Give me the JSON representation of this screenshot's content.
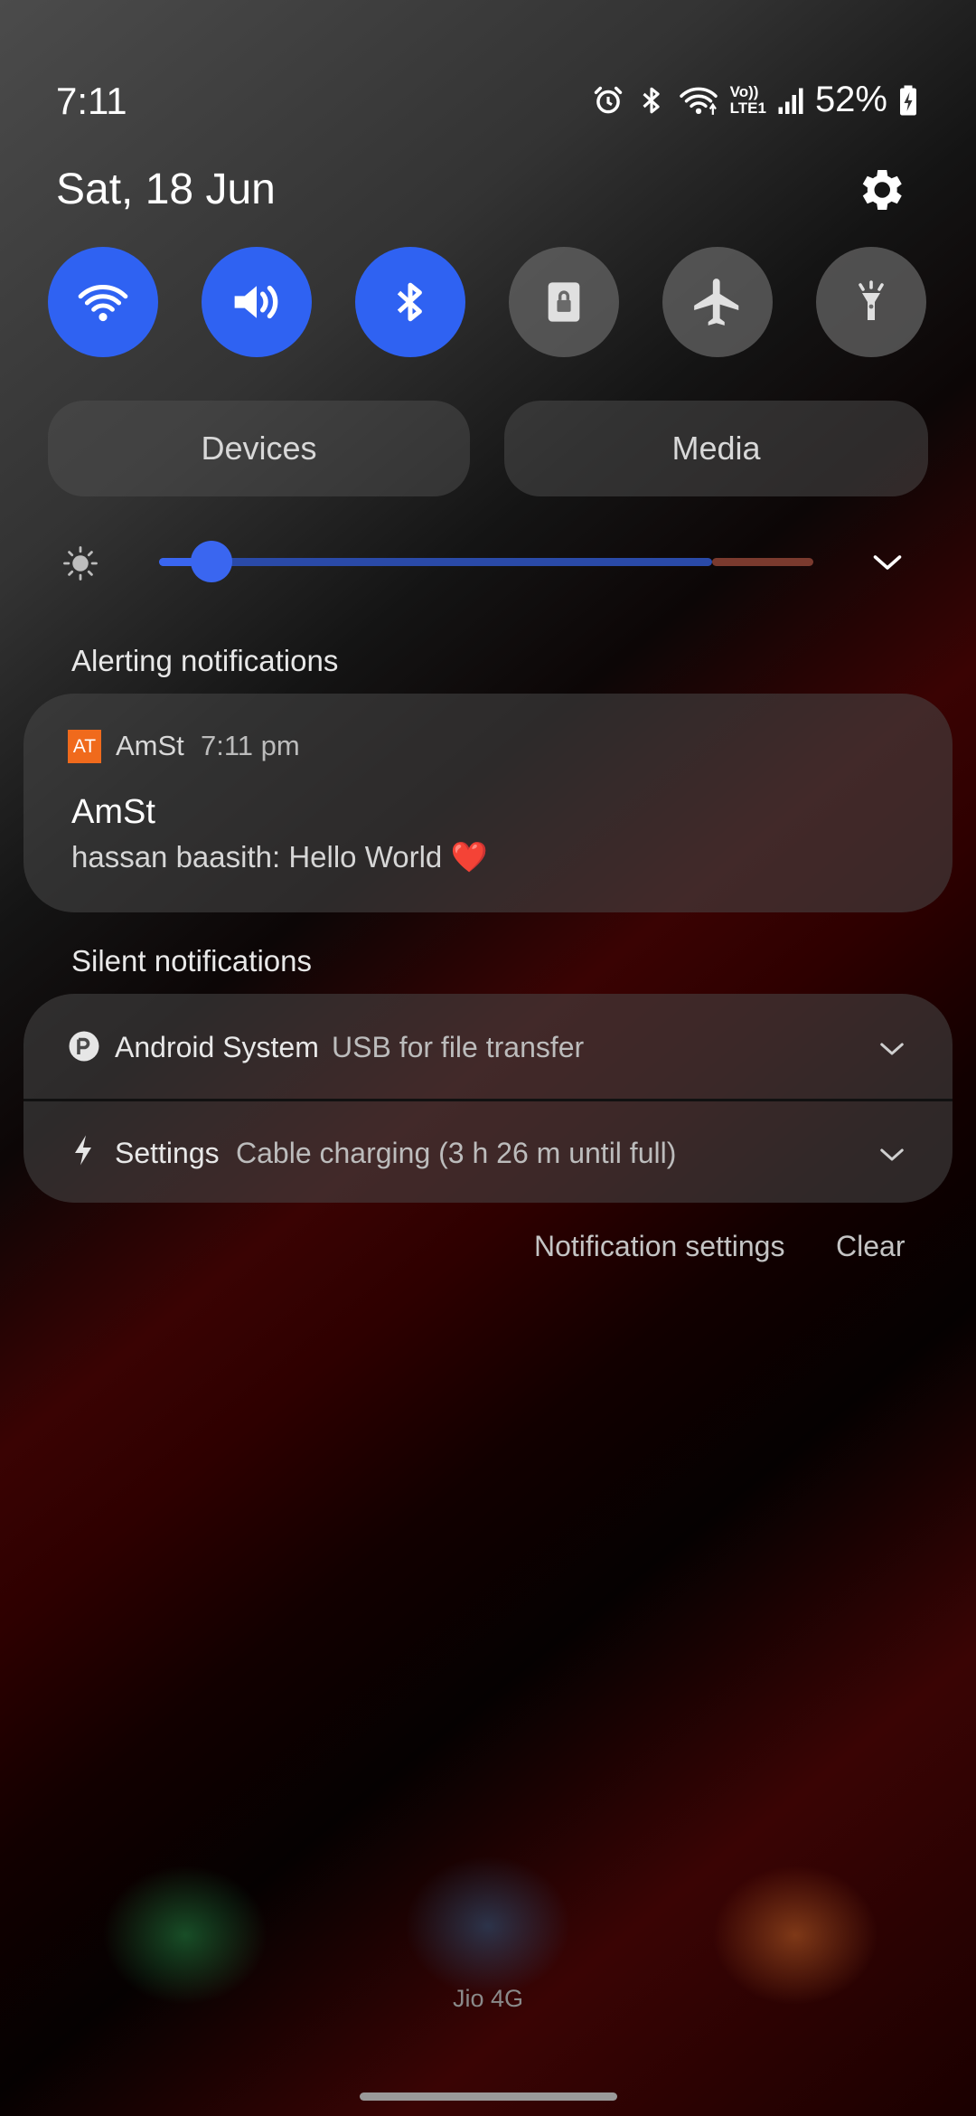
{
  "status_bar": {
    "time": "7:11",
    "battery": "52%",
    "icons": [
      "alarm-icon",
      "bluetooth-icon",
      "wifi-icon",
      "volte-lte-icon",
      "signal-icon",
      "battery-charging-icon"
    ],
    "volte_top": "Vo))",
    "volte_bottom": "LTE1"
  },
  "header": {
    "date": "Sat, 18 Jun"
  },
  "quick_toggles": [
    {
      "name": "wifi",
      "state": "on"
    },
    {
      "name": "sound",
      "state": "on"
    },
    {
      "name": "bluetooth",
      "state": "on"
    },
    {
      "name": "screen-lock",
      "state": "off"
    },
    {
      "name": "airplane-mode",
      "state": "off"
    },
    {
      "name": "flashlight",
      "state": "off"
    }
  ],
  "buttons": {
    "devices": "Devices",
    "media": "Media"
  },
  "brightness": {
    "level": 0.08
  },
  "alerting": {
    "section_label": "Alerting notifications",
    "notification": {
      "app_icon_text": "AT",
      "app_name": "AmSt",
      "time": "7:11 pm",
      "title": "AmSt",
      "message": "hassan baasith: Hello World ❤️"
    }
  },
  "silent": {
    "section_label": "Silent notifications",
    "items": [
      {
        "app": "Android System",
        "text": "USB for file transfer"
      },
      {
        "app": "Settings",
        "text": "Cable charging (3 h 26 m until full)"
      }
    ]
  },
  "actions": {
    "notification_settings": "Notification settings",
    "clear": "Clear"
  },
  "carrier": "Jio 4G",
  "colors": {
    "accent": "#2f62f2",
    "app_icon": "#f06a1c"
  }
}
